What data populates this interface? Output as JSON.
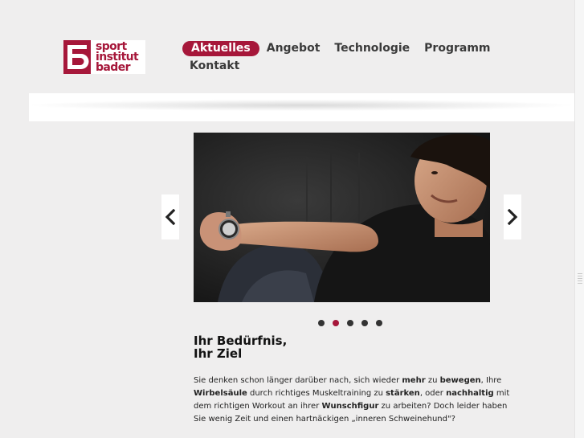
{
  "logo": {
    "mark": "B5",
    "lines": [
      "sport",
      "institut",
      "bader"
    ],
    "brand_color": "#a6173a"
  },
  "nav": {
    "row1": [
      {
        "label": "Aktuelles",
        "active": true
      },
      {
        "label": "Angebot",
        "active": false
      },
      {
        "label": "Technologie",
        "active": false
      },
      {
        "label": "Programm",
        "active": false
      }
    ],
    "row2": [
      {
        "label": "Kontakt",
        "active": false
      }
    ]
  },
  "slider": {
    "prev_icon": "chevron-left-icon",
    "next_icon": "chevron-right-icon",
    "image_subject": "man-with-stopwatch-photo",
    "slide_count": 5,
    "active_slide": 2
  },
  "content": {
    "headline": "Ihr Bedürfnis,\nIhr Ziel",
    "paragraph_parts": [
      {
        "t": "Sie denken schon länger darüber nach, sich wieder ",
        "b": false
      },
      {
        "t": "mehr",
        "b": true
      },
      {
        "t": " zu ",
        "b": false
      },
      {
        "t": "bewegen",
        "b": true
      },
      {
        "t": ", Ihre ",
        "b": false
      },
      {
        "t": "Wirbelsäule",
        "b": true
      },
      {
        "t": " durch richtiges Muskeltraining zu ",
        "b": false
      },
      {
        "t": "stärken",
        "b": true
      },
      {
        "t": ", oder ",
        "b": false
      },
      {
        "t": "nachhaltig",
        "b": true
      },
      {
        "t": " mit dem richtigen Workout an ihrer ",
        "b": false
      },
      {
        "t": "Wunschfigur",
        "b": true
      },
      {
        "t": " zu arbeiten? Doch leider haben Sie wenig Zeit und einen hartnäckigen „inneren Schweinehund\"?",
        "b": false
      }
    ]
  }
}
